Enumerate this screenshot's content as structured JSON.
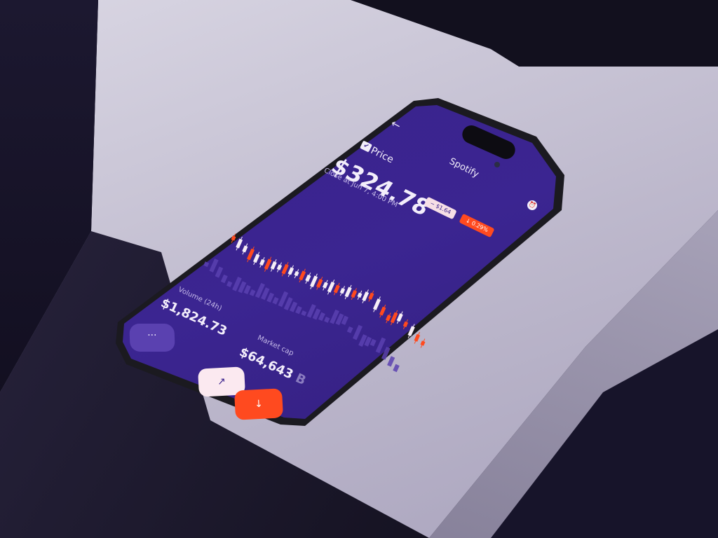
{
  "header": {
    "back_icon": "arrow-left-icon",
    "title": "Spotify",
    "alarm_icon": "alarm-clock-icon"
  },
  "price": {
    "label": "Price",
    "value": "$324.78",
    "close_info": "Close at Jun 7, 4:00 PM",
    "change_abs": "− $1.64",
    "change_pct": "↓ 0.29%"
  },
  "volume": {
    "label": "Volume (24h)",
    "value": "$1,824.73"
  },
  "market_cap": {
    "label": "Market cap",
    "value": "$64,643",
    "unit": "B"
  },
  "actions": {
    "more_label": "···",
    "send_label": "↗",
    "receive_label": "↓"
  },
  "colors": {
    "screen_bg": "#3b2591",
    "up_candle": "#f6eef6",
    "down_candle": "#ff4a1f",
    "volume_bar": "#5a41b0",
    "accent": "#ff4a1f"
  }
}
